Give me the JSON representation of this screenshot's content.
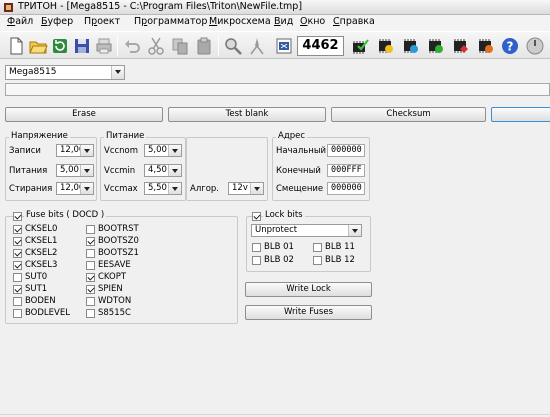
{
  "window": {
    "title": "ТРИТОН - [Mega8515 - C:\\Program Files\\Triton\\NewFile.tmp]"
  },
  "menu": [
    {
      "label": "Файл",
      "underline": "Ф",
      "rest": "айл"
    },
    {
      "label": "Буфер",
      "underline": "Б",
      "rest": "уфер"
    },
    {
      "label": "Проект",
      "underline": "р",
      "pre": "П",
      "rest": "оект"
    },
    {
      "label": "Программатор",
      "underline": "р",
      "pre": "П",
      "rest": "ограмматор"
    },
    {
      "label": "Микросхема",
      "underline": "М",
      "rest": "икросхема"
    },
    {
      "label": "Вид",
      "underline": "В",
      "rest": "ид"
    },
    {
      "label": "Окно",
      "underline": "О",
      "rest": "кно"
    },
    {
      "label": "Справка",
      "underline": "С",
      "rest": "правка"
    }
  ],
  "toolbar": {
    "counter": "4462",
    "icons": [
      "new-file-icon",
      "open-folder-icon",
      "refresh-icon",
      "save-icon",
      "print-icon",
      "undo-icon",
      "cut-icon",
      "copy-icon",
      "paste-icon",
      "find-icon",
      "replace-icon",
      "export-icon",
      "chip-verify-icon",
      "chip-read-icon",
      "chip-write-icon",
      "chip-erase-icon",
      "chip-protect-icon",
      "chip-auto-icon",
      "help-icon",
      "exit-icon"
    ]
  },
  "device": {
    "selected": "Mega8515"
  },
  "progress": {
    "value": 0
  },
  "actions": {
    "erase": "Erase",
    "test_blank": "Test blank",
    "checksum": "Checksum"
  },
  "voltage": {
    "title": "Напряжение",
    "rows": [
      {
        "label": "Записи",
        "value": "12,00"
      },
      {
        "label": "Питания",
        "value": "5,00"
      },
      {
        "label": "Стирания",
        "value": "12,00"
      }
    ]
  },
  "power": {
    "title": "Питание",
    "rows": [
      {
        "label": "Vccnom",
        "value": "5,00"
      },
      {
        "label": "Vccmin",
        "value": "4,50"
      },
      {
        "label": "Vccmax",
        "value": "5,50"
      }
    ]
  },
  "algorithm": {
    "label": "Алгор.",
    "value": "12v"
  },
  "address": {
    "title": "Адрес",
    "rows": [
      {
        "label": "Начальный",
        "value": "000000"
      },
      {
        "label": "Конечный",
        "value": "000FFF"
      },
      {
        "label": "Смещение",
        "value": "000000"
      }
    ]
  },
  "fuse": {
    "title": "Fuse bits  ( DOCD )",
    "checked": true,
    "left": [
      {
        "name": "CKSEL0",
        "checked": true
      },
      {
        "name": "CKSEL1",
        "checked": true
      },
      {
        "name": "CKSEL2",
        "checked": true
      },
      {
        "name": "CKSEL3",
        "checked": true
      },
      {
        "name": "SUT0",
        "checked": false
      },
      {
        "name": "SUT1",
        "checked": true
      },
      {
        "name": "BODEN",
        "checked": false
      },
      {
        "name": "BODLEVEL",
        "checked": false
      }
    ],
    "right": [
      {
        "name": "BOOTRST",
        "checked": false
      },
      {
        "name": "BOOTSZ0",
        "checked": true
      },
      {
        "name": "BOOTSZ1",
        "checked": false
      },
      {
        "name": "EESAVE",
        "checked": false
      },
      {
        "name": "CKOPT",
        "checked": true
      },
      {
        "name": "SPIEN",
        "checked": true
      },
      {
        "name": "WDTON",
        "checked": false
      },
      {
        "name": "S8515C",
        "checked": false
      }
    ]
  },
  "lock": {
    "title": "Lock bits",
    "checked": true,
    "mode": "Unprotect",
    "bits": [
      {
        "name": "BLB 01",
        "checked": false
      },
      {
        "name": "BLB 11",
        "checked": false
      },
      {
        "name": "BLB 02",
        "checked": false
      },
      {
        "name": "BLB 12",
        "checked": false
      }
    ],
    "write_lock": "Write Lock",
    "write_fuses": "Write Fuses"
  }
}
